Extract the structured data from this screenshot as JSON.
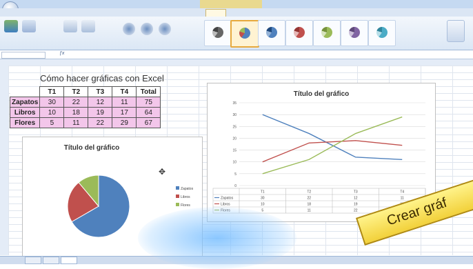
{
  "sheet": {
    "title": "Cómo hacer gráficas con Excel",
    "headers": [
      "",
      "T1",
      "T2",
      "T3",
      "T4",
      "Total"
    ],
    "rows": [
      {
        "label": "Zapatos",
        "values": [
          "30",
          "22",
          "12",
          "11",
          "75"
        ]
      },
      {
        "label": "Libros",
        "values": [
          "10",
          "18",
          "19",
          "17",
          "64"
        ]
      },
      {
        "label": "Flores",
        "values": [
          "5",
          "11",
          "22",
          "29",
          "67"
        ]
      }
    ]
  },
  "pie_chart": {
    "title": "Título del gráfico",
    "colors": [
      "#4f81bd",
      "#c0504d",
      "#9bbb59"
    ]
  },
  "line_chart": {
    "title": "Título del gráfico",
    "colors": [
      "#4f81bd",
      "#c0504d",
      "#9bbb59"
    ]
  },
  "banner": {
    "text": "Crear gráf"
  },
  "icons": {
    "office": "office-button-icon",
    "cursor": "move-cursor-icon"
  },
  "chart_data": [
    {
      "type": "pie",
      "categories": [
        "Zapatos",
        "Libros",
        "Flores"
      ],
      "values": [
        30,
        10,
        5
      ],
      "title": "Título del gráfico"
    },
    {
      "type": "line",
      "title": "Título del gráfico",
      "categories": [
        "T1",
        "T2",
        "T3",
        "T4"
      ],
      "series": [
        {
          "name": "Zapatos",
          "values": [
            30,
            22,
            12,
            11
          ]
        },
        {
          "name": "Libros",
          "values": [
            10,
            18,
            19,
            17
          ]
        },
        {
          "name": "Flores",
          "values": [
            5,
            11,
            22,
            29
          ]
        }
      ],
      "ylim": [
        0,
        35
      ],
      "grid": true,
      "legend": "bottom-table"
    }
  ]
}
